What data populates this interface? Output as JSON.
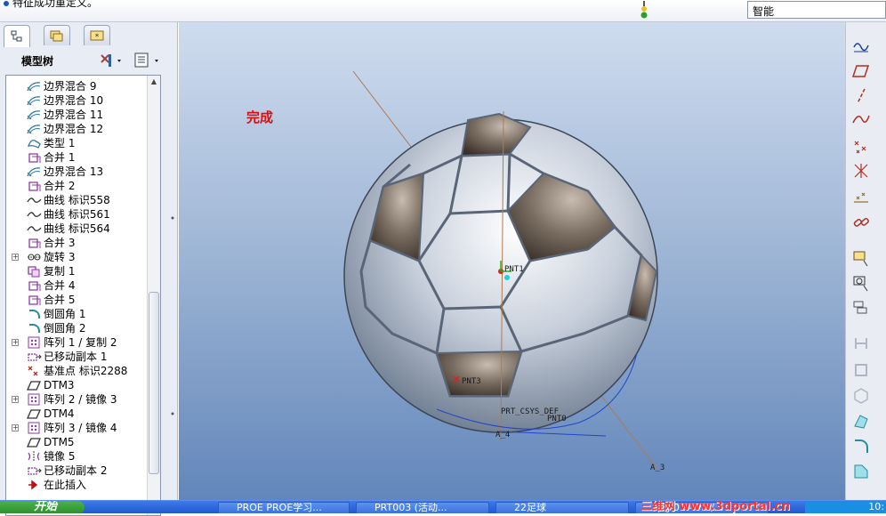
{
  "status_message": "特征成功重定义。",
  "filter_value": "智能",
  "model_tree": {
    "title": "模型树",
    "items": [
      {
        "label": "边界混合 9",
        "icon": "boundary-blend-icon",
        "expand": false
      },
      {
        "label": "边界混合 10",
        "icon": "boundary-blend-icon",
        "expand": false
      },
      {
        "label": "边界混合 11",
        "icon": "boundary-blend-icon",
        "expand": false
      },
      {
        "label": "边界混合 12",
        "icon": "boundary-blend-icon",
        "expand": false
      },
      {
        "label": "类型 1",
        "icon": "surface-icon",
        "expand": false
      },
      {
        "label": "合并 1",
        "icon": "merge-icon",
        "expand": false
      },
      {
        "label": "边界混合 13",
        "icon": "boundary-blend-icon",
        "expand": false
      },
      {
        "label": "合并 2",
        "icon": "merge-icon",
        "expand": false
      },
      {
        "label": "曲线 标识558",
        "icon": "curve-icon",
        "expand": false
      },
      {
        "label": "曲线 标识561",
        "icon": "curve-icon",
        "expand": false
      },
      {
        "label": "曲线 标识564",
        "icon": "curve-icon",
        "expand": false
      },
      {
        "label": "合并 3",
        "icon": "merge-icon",
        "expand": false
      },
      {
        "label": "旋转 3",
        "icon": "revolve-icon",
        "expand": true
      },
      {
        "label": "复制 1",
        "icon": "copy-icon",
        "expand": false
      },
      {
        "label": "合并 4",
        "icon": "merge-icon",
        "expand": false
      },
      {
        "label": "合并 5",
        "icon": "merge-icon",
        "expand": false
      },
      {
        "label": "倒圆角 1",
        "icon": "round-icon",
        "expand": false
      },
      {
        "label": "倒圆角 2",
        "icon": "round-icon",
        "expand": false
      },
      {
        "label": "阵列 1 / 复制 2",
        "icon": "pattern-icon",
        "expand": true
      },
      {
        "label": "已移动副本 1",
        "icon": "moved-copy-icon",
        "expand": false
      },
      {
        "label": "基准点 标识2288",
        "icon": "datum-point-icon",
        "expand": false
      },
      {
        "label": "DTM3",
        "icon": "datum-plane-icon",
        "expand": false
      },
      {
        "label": "阵列 2 / 镜像 3",
        "icon": "pattern-icon",
        "expand": true
      },
      {
        "label": "DTM4",
        "icon": "datum-plane-icon",
        "expand": false
      },
      {
        "label": "阵列 3 / 镜像 4",
        "icon": "pattern-icon",
        "expand": true
      },
      {
        "label": "DTM5",
        "icon": "datum-plane-icon",
        "expand": false
      },
      {
        "label": "镜像 5",
        "icon": "mirror-icon",
        "expand": false
      },
      {
        "label": "已移动副本 2",
        "icon": "moved-copy-icon",
        "expand": false
      },
      {
        "label": "在此插入",
        "icon": "insert-here-icon",
        "expand": false
      }
    ]
  },
  "viewport": {
    "status_label": "完成",
    "datum_labels": {
      "pnt1": "PNT1",
      "pnt3": "PNT3",
      "pnt0": "PNT0",
      "csys": "PRT_CSYS_DEF",
      "a4": "A_4",
      "a3": "A_3"
    }
  },
  "taskbar": {
    "start_label": "开始",
    "tasks": [
      "PROE PROE学习...",
      "PRT003 (活动...",
      "22足球",
      "ZZJ-01 - Pro/..."
    ],
    "watermark": "三维网 www.3dportal.cn",
    "clock": "10:"
  },
  "colors": {
    "accent": "#2158d0",
    "status_red": "#d81010",
    "viewport_bg": "#9cb4d4"
  }
}
